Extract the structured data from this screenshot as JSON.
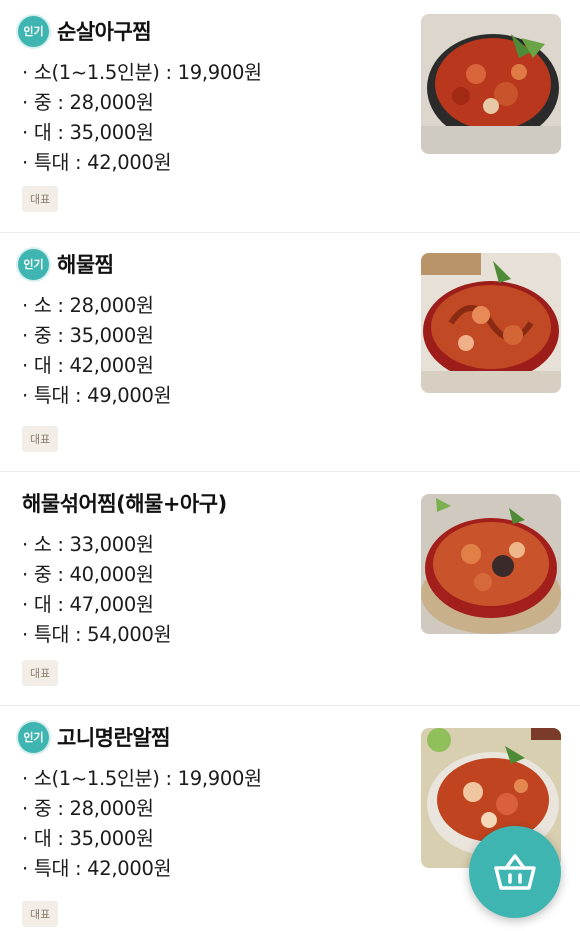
{
  "menu": [
    {
      "badge": "인기",
      "name": "순살아구찜",
      "options": [
        "소(1~1.5인분) : 19,900원",
        "중 : 28,000원",
        "대 : 35,000원",
        "특대 : 42,000원"
      ],
      "tag": "대표",
      "image": "spicy-monkfish-stew-photo"
    },
    {
      "badge": "인기",
      "name": "해물찜",
      "options": [
        "소 : 28,000원",
        "중 : 35,000원",
        "대 : 42,000원",
        "특대 : 49,000원"
      ],
      "tag": "대표",
      "image": "spicy-seafood-stew-photo"
    },
    {
      "name": "해물섞어찜(해물+아구)",
      "options": [
        "소 : 33,000원",
        "중 : 40,000원",
        "대 : 47,000원",
        "특대 : 54,000원"
      ],
      "tag": "대표",
      "image": "mixed-seafood-monkfish-stew-photo"
    },
    {
      "badge": "인기",
      "name": "고니명란알찜",
      "options": [
        "소(1~1.5인분) : 19,900원",
        "중 : 28,000원",
        "대 : 35,000원",
        "특대 : 42,000원"
      ],
      "tag": "대표",
      "image": "cod-roe-stew-photo"
    }
  ],
  "cart_button": {
    "icon": "shopping-basket-icon"
  },
  "colors": {
    "accent": "#3fb5b2",
    "tag_bg": "#f2ede6",
    "tag_text": "#8a7d6c"
  }
}
